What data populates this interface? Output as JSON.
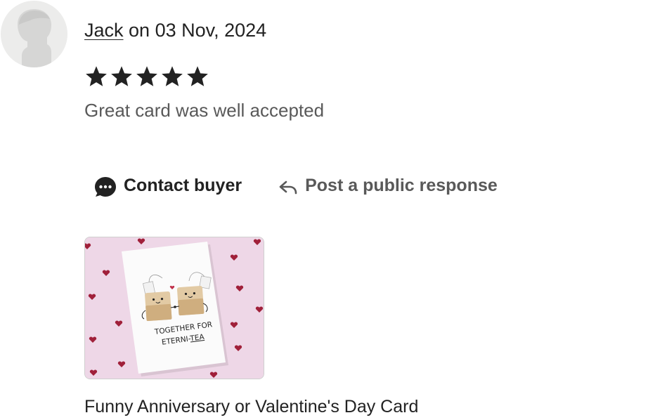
{
  "review": {
    "reviewer_name": "Jack",
    "date_text": " on 03 Nov, 2024",
    "rating": 5,
    "rating_max": 5,
    "text": "Great card was well accepted"
  },
  "actions": {
    "contact_label": "Contact buyer",
    "respond_label": "Post a public response"
  },
  "product": {
    "card_line1": "TOGETHER FOR",
    "card_line2_prefix": "ETERNI-",
    "card_line2_emph": "TEA",
    "title": "Funny Anniversary or Valentine's Day Card"
  },
  "colors": {
    "text": "#222222",
    "muted": "#595959",
    "star": "#222222",
    "card_bg": "#eed7e7",
    "heart": "#a0203a"
  },
  "icons": {
    "avatar": "default-avatar-icon",
    "star": "star-icon",
    "contact": "chat-bubble-icon",
    "respond": "reply-arrow-icon"
  }
}
